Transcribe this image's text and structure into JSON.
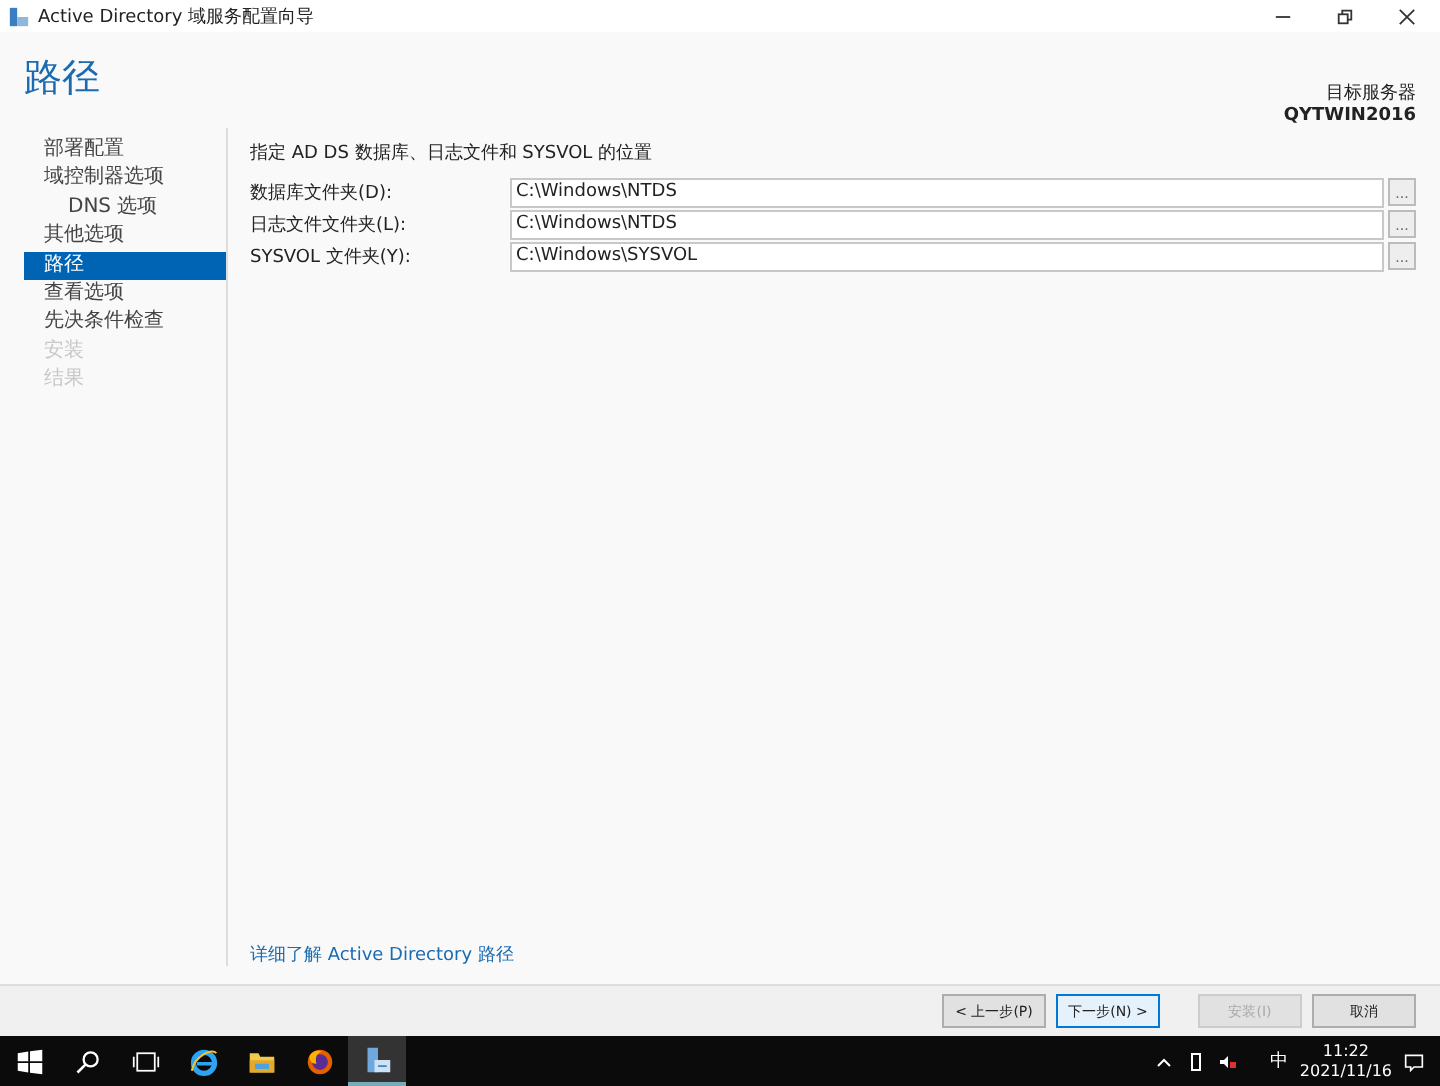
{
  "window": {
    "title": "Active Directory 域服务配置向导"
  },
  "header": {
    "title": "路径",
    "target_label": "目标服务器",
    "target_name": "QYTWIN2016"
  },
  "sidebar": {
    "items": [
      {
        "label": "部署配置",
        "selected": false,
        "disabled": false
      },
      {
        "label": "域控制器选项",
        "selected": false,
        "disabled": false,
        "children": [
          {
            "label": "DNS 选项",
            "selected": false,
            "disabled": false
          }
        ]
      },
      {
        "label": "其他选项",
        "selected": false,
        "disabled": false
      },
      {
        "label": "路径",
        "selected": true,
        "disabled": false
      },
      {
        "label": "查看选项",
        "selected": false,
        "disabled": false
      },
      {
        "label": "先决条件检查",
        "selected": false,
        "disabled": false
      },
      {
        "label": "安装",
        "selected": false,
        "disabled": true
      },
      {
        "label": "结果",
        "selected": false,
        "disabled": true
      }
    ]
  },
  "content": {
    "heading": "指定 AD DS 数据库、日志文件和 SYSVOL 的位置",
    "fields": [
      {
        "label": "数据库文件夹(D):",
        "value": "C:\\Windows\\NTDS",
        "browse": "..."
      },
      {
        "label": "日志文件文件夹(L):",
        "value": "C:\\Windows\\NTDS",
        "browse": "..."
      },
      {
        "label": "SYSVOL 文件夹(Y):",
        "value": "C:\\Windows\\SYSVOL",
        "browse": "..."
      }
    ],
    "link": "详细了解 Active Directory 路径"
  },
  "buttons": [
    {
      "label": "< 上一步(P)",
      "disabled": false,
      "default": false
    },
    {
      "label": "下一步(N) >",
      "disabled": false,
      "default": true
    },
    {
      "label": "安装(I)",
      "disabled": true,
      "default": false
    },
    {
      "label": "取消",
      "disabled": false,
      "default": false
    }
  ],
  "taskbar": {
    "apps": [
      {
        "kind": "start",
        "active": false
      },
      {
        "kind": "search",
        "active": false
      },
      {
        "kind": "taskview",
        "active": false
      },
      {
        "kind": "ie",
        "active": false
      },
      {
        "kind": "folder",
        "active": false
      },
      {
        "kind": "firefox",
        "active": false
      },
      {
        "kind": "server",
        "active": true
      }
    ],
    "ime": "中",
    "time": "11:22",
    "date": "2021/11/16"
  }
}
